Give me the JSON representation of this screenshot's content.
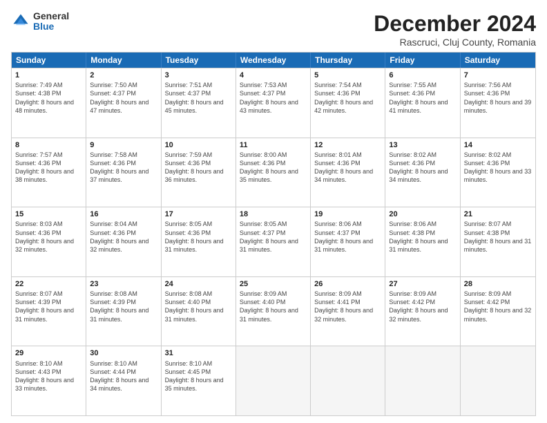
{
  "logo": {
    "general": "General",
    "blue": "Blue"
  },
  "title": {
    "month": "December 2024",
    "location": "Rascruci, Cluj County, Romania"
  },
  "header": {
    "days": [
      "Sunday",
      "Monday",
      "Tuesday",
      "Wednesday",
      "Thursday",
      "Friday",
      "Saturday"
    ]
  },
  "weeks": [
    [
      {
        "day": "1",
        "sunrise": "7:49 AM",
        "sunset": "4:38 PM",
        "daylight": "8 hours and 48 minutes."
      },
      {
        "day": "2",
        "sunrise": "7:50 AM",
        "sunset": "4:37 PM",
        "daylight": "8 hours and 47 minutes."
      },
      {
        "day": "3",
        "sunrise": "7:51 AM",
        "sunset": "4:37 PM",
        "daylight": "8 hours and 45 minutes."
      },
      {
        "day": "4",
        "sunrise": "7:53 AM",
        "sunset": "4:37 PM",
        "daylight": "8 hours and 43 minutes."
      },
      {
        "day": "5",
        "sunrise": "7:54 AM",
        "sunset": "4:36 PM",
        "daylight": "8 hours and 42 minutes."
      },
      {
        "day": "6",
        "sunrise": "7:55 AM",
        "sunset": "4:36 PM",
        "daylight": "8 hours and 41 minutes."
      },
      {
        "day": "7",
        "sunrise": "7:56 AM",
        "sunset": "4:36 PM",
        "daylight": "8 hours and 39 minutes."
      }
    ],
    [
      {
        "day": "8",
        "sunrise": "7:57 AM",
        "sunset": "4:36 PM",
        "daylight": "8 hours and 38 minutes."
      },
      {
        "day": "9",
        "sunrise": "7:58 AM",
        "sunset": "4:36 PM",
        "daylight": "8 hours and 37 minutes."
      },
      {
        "day": "10",
        "sunrise": "7:59 AM",
        "sunset": "4:36 PM",
        "daylight": "8 hours and 36 minutes."
      },
      {
        "day": "11",
        "sunrise": "8:00 AM",
        "sunset": "4:36 PM",
        "daylight": "8 hours and 35 minutes."
      },
      {
        "day": "12",
        "sunrise": "8:01 AM",
        "sunset": "4:36 PM",
        "daylight": "8 hours and 34 minutes."
      },
      {
        "day": "13",
        "sunrise": "8:02 AM",
        "sunset": "4:36 PM",
        "daylight": "8 hours and 34 minutes."
      },
      {
        "day": "14",
        "sunrise": "8:02 AM",
        "sunset": "4:36 PM",
        "daylight": "8 hours and 33 minutes."
      }
    ],
    [
      {
        "day": "15",
        "sunrise": "8:03 AM",
        "sunset": "4:36 PM",
        "daylight": "8 hours and 32 minutes."
      },
      {
        "day": "16",
        "sunrise": "8:04 AM",
        "sunset": "4:36 PM",
        "daylight": "8 hours and 32 minutes."
      },
      {
        "day": "17",
        "sunrise": "8:05 AM",
        "sunset": "4:36 PM",
        "daylight": "8 hours and 31 minutes."
      },
      {
        "day": "18",
        "sunrise": "8:05 AM",
        "sunset": "4:37 PM",
        "daylight": "8 hours and 31 minutes."
      },
      {
        "day": "19",
        "sunrise": "8:06 AM",
        "sunset": "4:37 PM",
        "daylight": "8 hours and 31 minutes."
      },
      {
        "day": "20",
        "sunrise": "8:06 AM",
        "sunset": "4:38 PM",
        "daylight": "8 hours and 31 minutes."
      },
      {
        "day": "21",
        "sunrise": "8:07 AM",
        "sunset": "4:38 PM",
        "daylight": "8 hours and 31 minutes."
      }
    ],
    [
      {
        "day": "22",
        "sunrise": "8:07 AM",
        "sunset": "4:39 PM",
        "daylight": "8 hours and 31 minutes."
      },
      {
        "day": "23",
        "sunrise": "8:08 AM",
        "sunset": "4:39 PM",
        "daylight": "8 hours and 31 minutes."
      },
      {
        "day": "24",
        "sunrise": "8:08 AM",
        "sunset": "4:40 PM",
        "daylight": "8 hours and 31 minutes."
      },
      {
        "day": "25",
        "sunrise": "8:09 AM",
        "sunset": "4:40 PM",
        "daylight": "8 hours and 31 minutes."
      },
      {
        "day": "26",
        "sunrise": "8:09 AM",
        "sunset": "4:41 PM",
        "daylight": "8 hours and 32 minutes."
      },
      {
        "day": "27",
        "sunrise": "8:09 AM",
        "sunset": "4:42 PM",
        "daylight": "8 hours and 32 minutes."
      },
      {
        "day": "28",
        "sunrise": "8:09 AM",
        "sunset": "4:42 PM",
        "daylight": "8 hours and 32 minutes."
      }
    ],
    [
      {
        "day": "29",
        "sunrise": "8:10 AM",
        "sunset": "4:43 PM",
        "daylight": "8 hours and 33 minutes."
      },
      {
        "day": "30",
        "sunrise": "8:10 AM",
        "sunset": "4:44 PM",
        "daylight": "8 hours and 34 minutes."
      },
      {
        "day": "31",
        "sunrise": "8:10 AM",
        "sunset": "4:45 PM",
        "daylight": "8 hours and 35 minutes."
      },
      null,
      null,
      null,
      null
    ]
  ],
  "labels": {
    "sunrise": "Sunrise:",
    "sunset": "Sunset:",
    "daylight": "Daylight:"
  }
}
